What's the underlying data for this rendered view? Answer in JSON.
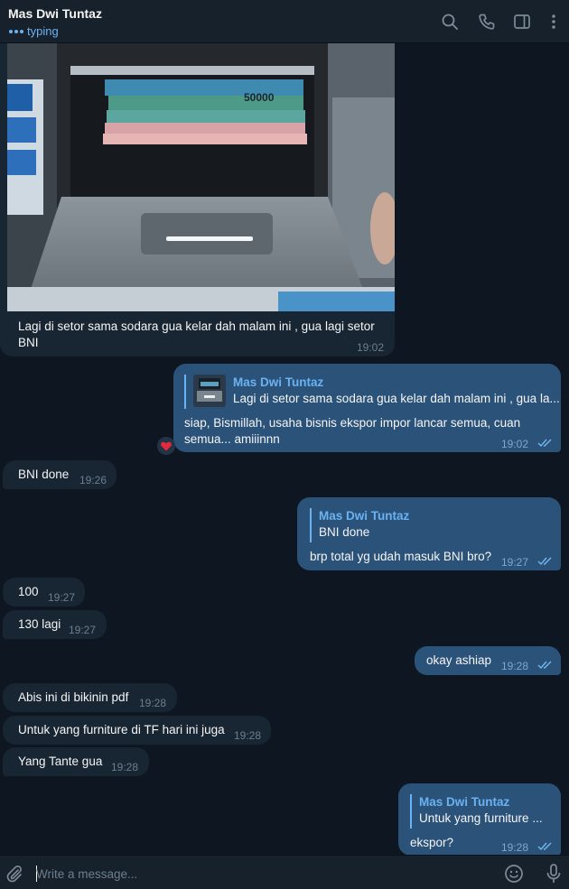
{
  "header": {
    "contact_name": "Mas Dwi Tuntaz",
    "status": "typing"
  },
  "messages": {
    "m1": {
      "text_line1": "Lagi di setor sama sodara gua kelar dah malam ini , gua lagi setor",
      "text_line2": "BNI",
      "time": "19:02",
      "photo_label": "50000"
    },
    "m2": {
      "reply_name": "Mas Dwi Tuntaz",
      "reply_text": "Lagi di setor sama sodara gua kelar dah malam ini , gua la...",
      "text_line1": "siap, Bismillah, usaha bisnis ekspor impor lancar semua, cuan",
      "text_line2": "semua... amiiinnn",
      "time": "19:02",
      "reaction": "❤️"
    },
    "m3": {
      "text": "BNI done",
      "time": "19:26"
    },
    "m4": {
      "reply_name": "Mas Dwi Tuntaz",
      "reply_text": "BNI done",
      "text": "brp total yg udah masuk BNI bro?",
      "time": "19:27"
    },
    "m5": {
      "text": "100",
      "time": "19:27"
    },
    "m6": {
      "text": "130 lagi",
      "time": "19:27"
    },
    "m7": {
      "text": "okay ashiap",
      "time": "19:28"
    },
    "m8": {
      "text": "Abis ini di bikinin pdf",
      "time": "19:28"
    },
    "m9": {
      "text": "Untuk yang furniture di TF hari ini juga",
      "time": "19:28"
    },
    "m10": {
      "text": "Yang Tante gua",
      "time": "19:28"
    },
    "m11": {
      "reply_name": "Mas Dwi Tuntaz",
      "reply_text": "Untuk yang furniture ...",
      "text": "ekspor?",
      "time": "19:28"
    }
  },
  "composer": {
    "placeholder": "Write a message..."
  },
  "colors": {
    "background": "#0e1621",
    "header": "#17212b",
    "incoming_bubble": "#182533",
    "outgoing_bubble": "#2b5278",
    "accent": "#6ab2f2"
  },
  "icons": [
    "search-icon",
    "phone-icon",
    "sidebar-toggle-icon",
    "more-vert-icon",
    "attach-icon",
    "emoji-icon",
    "microphone-icon",
    "double-check-icon",
    "heart-icon"
  ]
}
